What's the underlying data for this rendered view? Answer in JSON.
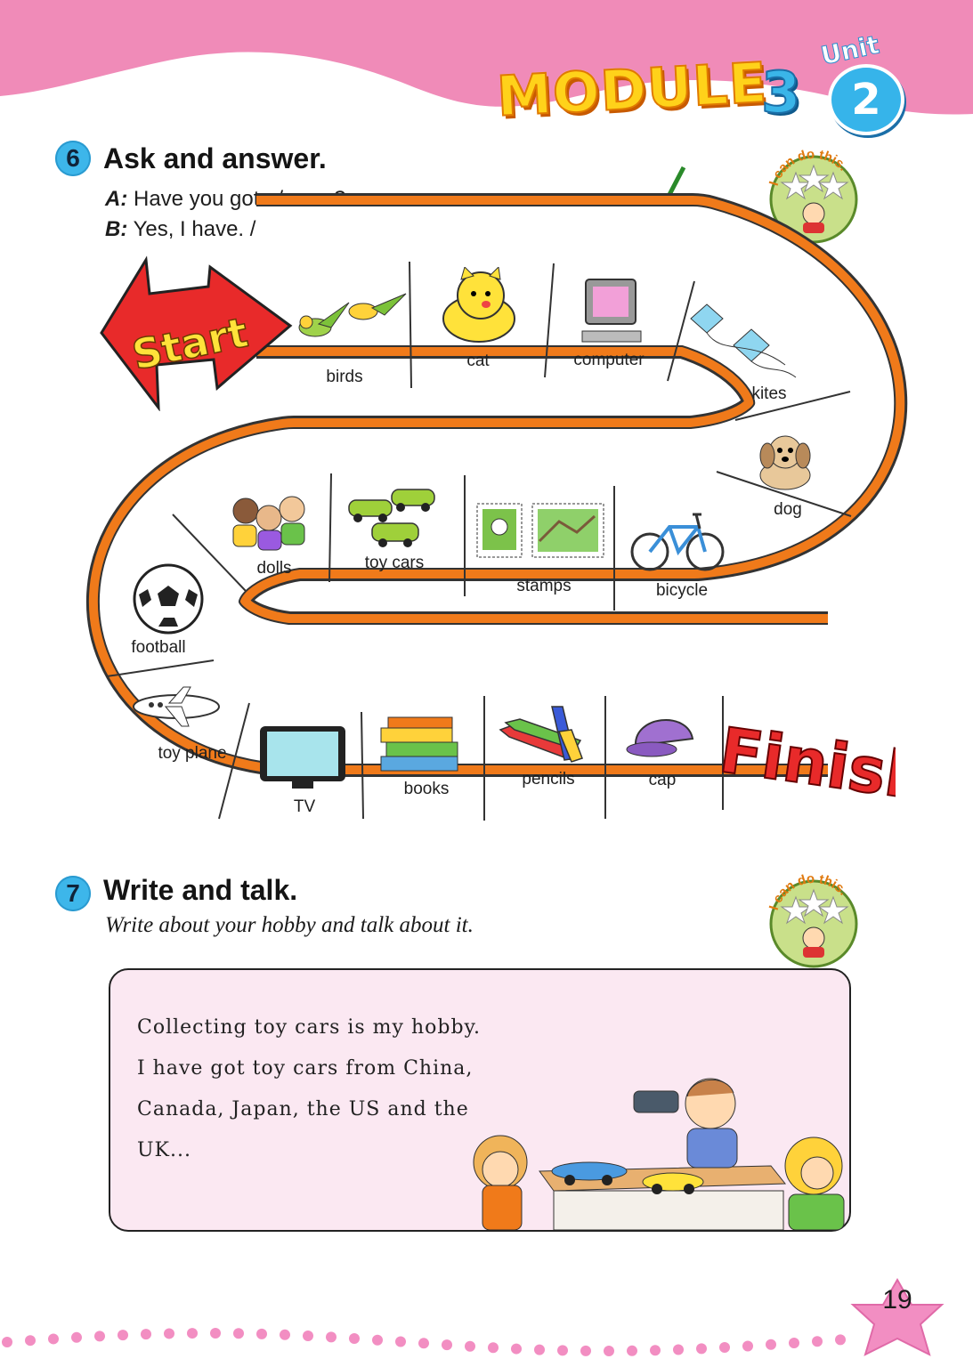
{
  "header": {
    "module_label": "MODULE",
    "module_number": "3",
    "unit_word": "Unit",
    "unit_number": "2"
  },
  "section6": {
    "number": "6",
    "title": "Ask and answer.",
    "dialog": [
      {
        "speaker": "A:",
        "text": " Have you got a/any...?"
      },
      {
        "speaker": "B:",
        "text": " Yes, I have. / No, I haven't. Have you?"
      }
    ],
    "badge_text": "I can do this."
  },
  "board": {
    "start_label": "Start",
    "finish_label": "Finish",
    "cells": [
      "birds",
      "cat",
      "computer",
      "kites",
      "dog",
      "bicycle",
      "stamps",
      "toy cars",
      "dolls",
      "football",
      "toy plane",
      "TV",
      "books",
      "pencils",
      "cap"
    ]
  },
  "section7": {
    "number": "7",
    "title": "Write and talk.",
    "instruction": "Write about your hobby and talk about it.",
    "badge_text": "I can do this.",
    "text_lines": [
      "Collecting toy cars is my hobby.",
      "I have got toy cars from China,",
      "Canada, Japan, the US and the",
      "UK..."
    ]
  },
  "footer": {
    "page_number": "19"
  },
  "colors": {
    "header_pink": "#f08bb8",
    "track_orange": "#f07a1a",
    "accent_blue": "#3db6ea",
    "box_pink": "#fbe8f2"
  }
}
